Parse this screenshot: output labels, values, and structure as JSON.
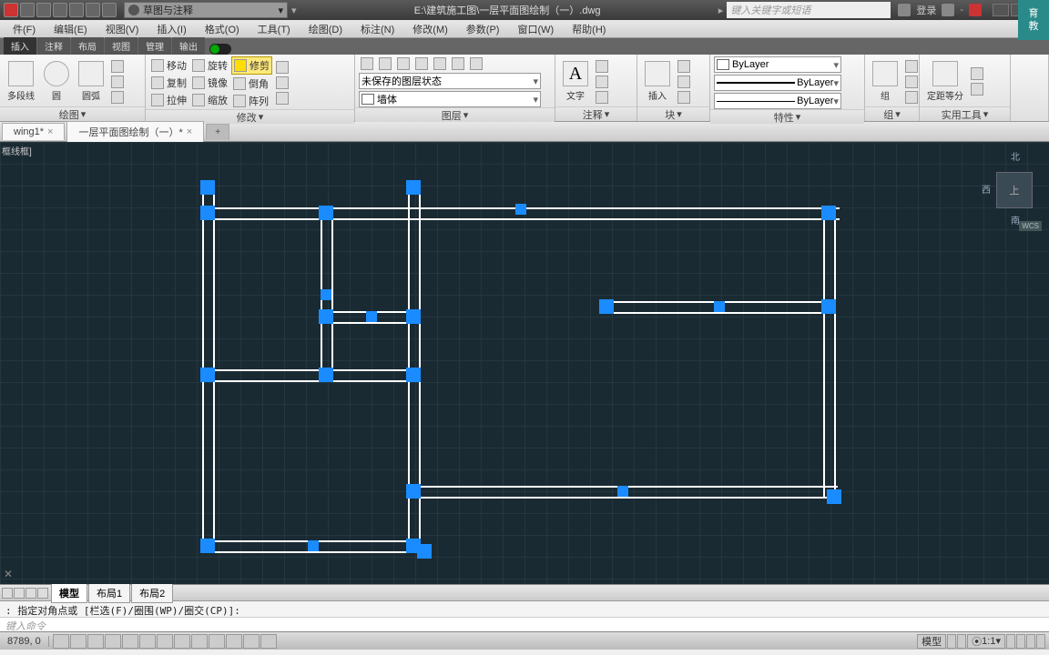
{
  "title_file": "E:\\建筑施工图\\一层平面图绘制（一）.dwg",
  "workspace": "草图与注释",
  "search_placeholder": "键入关键字或短语",
  "login": "登录",
  "menus": [
    "件(F)",
    "编辑(E)",
    "视图(V)",
    "插入(I)",
    "格式(O)",
    "工具(T)",
    "绘图(D)",
    "标注(N)",
    "修改(M)",
    "参数(P)",
    "窗口(W)",
    "帮助(H)"
  ],
  "ribbon_tabs": [
    "插入",
    "注释",
    "布局",
    "视图",
    "管理",
    "输出"
  ],
  "panels": {
    "draw": {
      "title": "绘图",
      "items": [
        "多段线",
        "圆",
        "圆弧"
      ]
    },
    "modify": {
      "title": "修改",
      "move": "移动",
      "rotate": "旋转",
      "trim": "修剪",
      "copy": "复制",
      "mirror": "镜像",
      "fillet": "倒角",
      "stretch": "拉伸",
      "scale": "缩放",
      "array": "阵列"
    },
    "layer": {
      "title": "图层",
      "state": "未保存的图层状态",
      "filter": "墙体"
    },
    "annot": {
      "title": "注释",
      "text": "文字"
    },
    "block": {
      "title": "块",
      "insert": "插入"
    },
    "props": {
      "title": "特性",
      "bylayer": "ByLayer"
    },
    "group": {
      "title": "组",
      "g": "组"
    },
    "util": {
      "title": "实用工具",
      "measure": "定距等分"
    }
  },
  "filetabs": [
    "wing1*",
    "一层平面图绘制（一）*"
  ],
  "canvas_label": "框线框]",
  "viewcube": {
    "n": "北",
    "w": "西",
    "s": "南",
    "top": "上",
    "wcs": "WCS"
  },
  "layout_tabs": [
    "模型",
    "布局1",
    "布局2"
  ],
  "cmd_history": ": 指定对角点或 [栏选(F)/圈围(WP)/圈交(CP)]:",
  "cmd_prompt": "键入命令",
  "status": {
    "coord": "8789, 0",
    "scale": "1:1"
  },
  "watermark": {
    "l1": "育",
    "l2": "教"
  }
}
